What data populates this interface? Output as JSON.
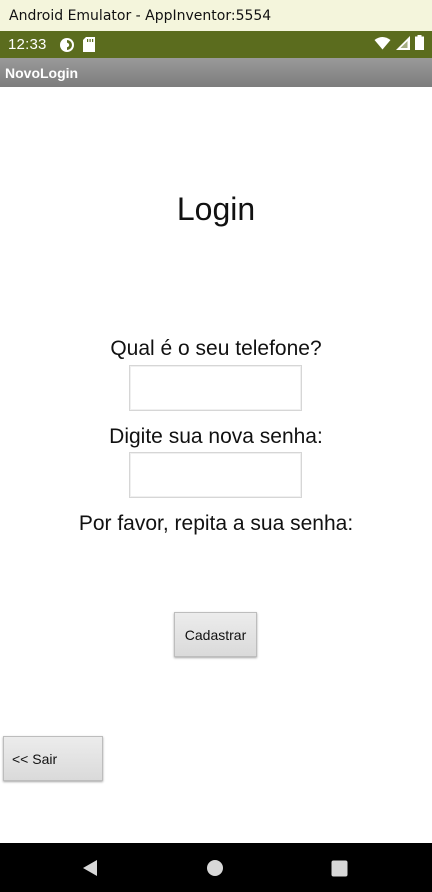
{
  "window": {
    "title": "Android Emulator - AppInventor:5554"
  },
  "statusbar": {
    "time": "12:33"
  },
  "appbar": {
    "title": "NovoLogin"
  },
  "screen": {
    "title": "Login",
    "phone_label": "Qual é o seu telefone?",
    "phone_value": "",
    "password_label": "Digite sua nova senha:",
    "password_value": "",
    "repeat_label": "Por favor, repita a sua senha:",
    "register_button": "Cadastrar",
    "exit_button": "<< Sair"
  },
  "colors": {
    "statusbar": "#5b6c1e",
    "appbar": "#8c8c8c",
    "window_titlebar": "#f4f5dc",
    "navbar": "#000000"
  },
  "icons": {
    "status_left": [
      "sync-icon",
      "sd-card-icon"
    ],
    "status_right": [
      "wifi-icon",
      "cell-signal-icon",
      "battery-icon"
    ],
    "navigation": [
      "back-icon",
      "home-icon",
      "recents-icon"
    ]
  }
}
